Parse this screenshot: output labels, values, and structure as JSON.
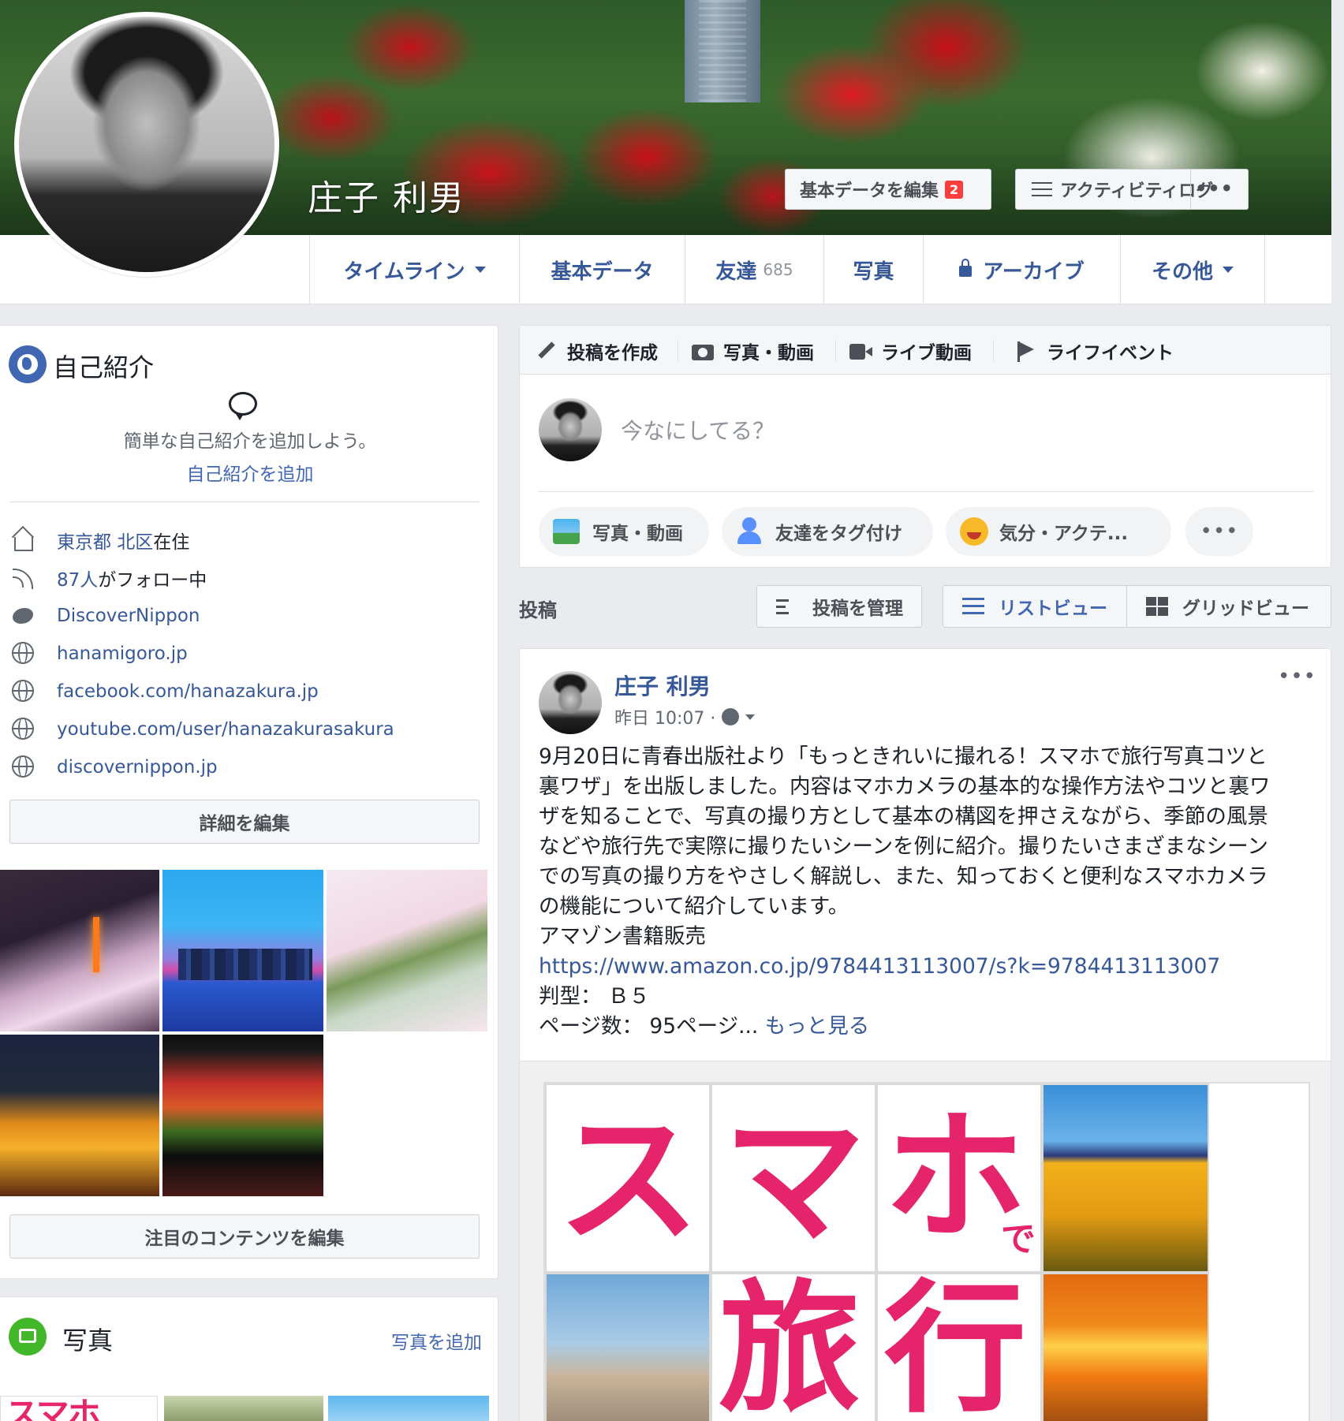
{
  "profile": {
    "name": "庄子 利男"
  },
  "cover_buttons": {
    "edit_label": "基本データを編集",
    "edit_badge": "2",
    "activity_label": "アクティビティログ",
    "more": "•••"
  },
  "nav": {
    "timeline": "タイムライン",
    "about": "基本データ",
    "friends": "友達",
    "friends_count": "685",
    "photos": "写真",
    "archive": "アーカイブ",
    "more": "その他"
  },
  "intro": {
    "title": "自己紹介",
    "hint": "簡単な自己紹介を追加しよう。",
    "add_link": "自己紹介を追加",
    "rows": [
      {
        "icon": "home-icon",
        "link": "東京都 北区",
        "text": "在住"
      },
      {
        "icon": "rss-icon",
        "link": "87人",
        "text": "がフォロー中"
      },
      {
        "icon": "twitter-icon",
        "link": "DiscoverNippon",
        "text": ""
      },
      {
        "icon": "globe-icon",
        "link": "hanamigoro.jp",
        "text": ""
      },
      {
        "icon": "globe-icon",
        "link": "facebook.com/hanazakura.jp",
        "text": ""
      },
      {
        "icon": "globe-icon",
        "link": "youtube.com/user/hanazakurasakura",
        "text": ""
      },
      {
        "icon": "globe-icon",
        "link": "discovernippon.jp",
        "text": ""
      }
    ],
    "edit_details": "詳細を編集",
    "edit_featured": "注目のコンテンツを編集"
  },
  "photos_card": {
    "title": "写真",
    "add_link": "写真を追加",
    "thumb1_text": "スマホ"
  },
  "composer": {
    "tabs": [
      "投稿を作成",
      "写真・動画",
      "ライブ動画",
      "ライフイベント"
    ],
    "placeholder": "今なにしてる？",
    "pills": [
      "写真・動画",
      "友達をタグ付け",
      "気分・アクテ..."
    ],
    "more": "•••"
  },
  "posts_header": {
    "label": "投稿",
    "manage": "投稿を管理",
    "list_view": "リストビュー",
    "grid_view": "グリッドビュー"
  },
  "post": {
    "author": "庄子 利男",
    "time": "昨日 10:07 ·",
    "more": "•••",
    "lines": [
      "9月20日に青春出版社より「もっときれいに撮れる！スマホで旅行写真コツと",
      "裏ワザ」を出版しました。内容はマホカメラの基本的な操作方法やコツと裏ワ",
      "ザを知ることで、写真の撮り方として基本の構図を押さえながら、季節の風景",
      "などや旅行先で実際に撮りたいシーンを例に紹介。撮りたいさまざまなシーン",
      "での写真の撮り方をやさしく解説し、また、知っておくと便利なスマホカメラ",
      "の機能について紹介しています。",
      "アマゾン書籍販売"
    ],
    "url": "https://www.amazon.co.jp/9784413113007/s?k=9784413113007",
    "size_line": "判型： Ｂ５",
    "pages_line": "ページ数： 95ページ...",
    "see_more": "もっと見る",
    "book": {
      "char1": "ス",
      "char2": "マ",
      "char3": "ホ",
      "small": "で",
      "char4": "旅",
      "char5": "行"
    }
  }
}
